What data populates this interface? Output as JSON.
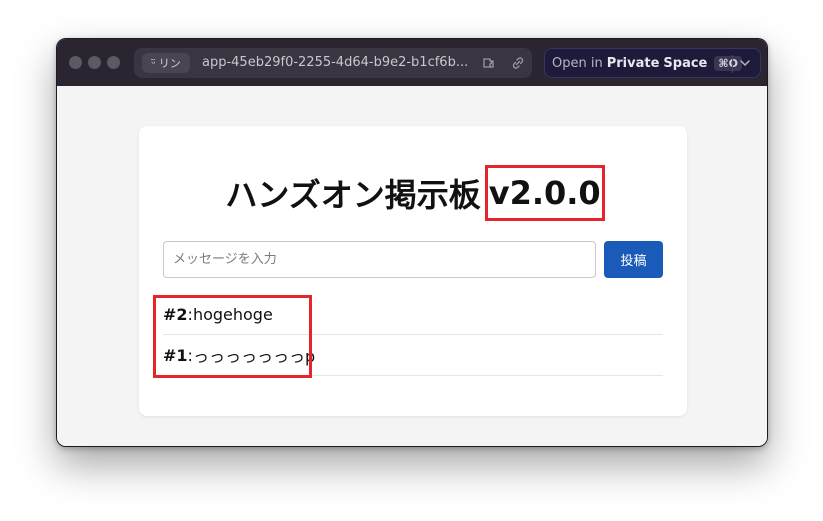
{
  "browser": {
    "profile_label": "リン",
    "url": "app-45eb29f0-2255-4d64-b9e2-b1cf6b...",
    "open_in_prefix": "Open in",
    "open_in_private": "Private",
    "open_in_space": "Space",
    "shortcut": "⌘O"
  },
  "app": {
    "title": "ハンズオン掲示板",
    "version": "v2.0.0",
    "input_placeholder": "メッセージを入力",
    "input_value": "",
    "submit_label": "投稿"
  },
  "posts": [
    {
      "num": "#2",
      "sep": ": ",
      "text": "hogehoge"
    },
    {
      "num": "#1",
      "sep": ": ",
      "text": "っっっっっっっp"
    }
  ],
  "colors": {
    "accent_button": "#1a5ab8",
    "annotation_red": "#e4262a",
    "titlebar": "#2a2530"
  }
}
